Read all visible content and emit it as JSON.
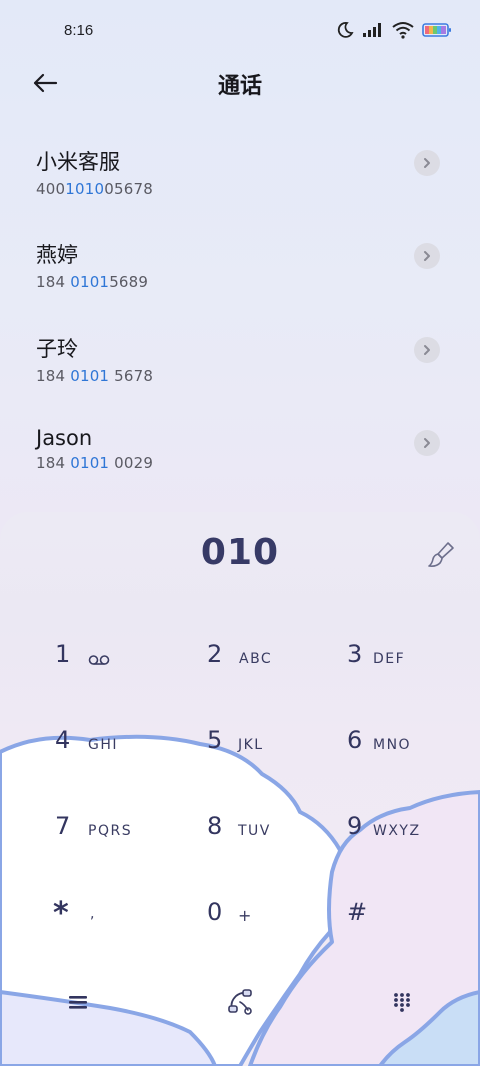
{
  "status_bar": {
    "time": "8:16",
    "icons": [
      "moon-icon",
      "signal-icon",
      "wifi-icon",
      "battery-icon"
    ]
  },
  "header": {
    "title": "通话",
    "back_icon": "arrow-left-icon"
  },
  "contacts": [
    {
      "name": "小米客服",
      "number_pre": "400",
      "number_hl": "1010",
      "number_post": "05678"
    },
    {
      "name": "燕婷",
      "number_pre": "184 ",
      "number_hl": "0101",
      "number_post": "5689"
    },
    {
      "name": "子玲",
      "number_pre": "184 ",
      "number_hl": "0101",
      "number_post": " 5678"
    },
    {
      "name": "Jason",
      "number_pre": "184 ",
      "number_hl": "0101",
      "number_post": " 0029"
    }
  ],
  "dialer": {
    "input": "010",
    "keys": [
      {
        "digit": "1",
        "letters": ""
      },
      {
        "digit": "2",
        "letters": "ABC"
      },
      {
        "digit": "3",
        "letters": "DEF"
      },
      {
        "digit": "4",
        "letters": "GHI"
      },
      {
        "digit": "5",
        "letters": "JKL"
      },
      {
        "digit": "6",
        "letters": "MNO"
      },
      {
        "digit": "7",
        "letters": "PQRS"
      },
      {
        "digit": "8",
        "letters": "TUV"
      },
      {
        "digit": "9",
        "letters": "WXYZ"
      },
      {
        "digit": "*",
        "letters": ","
      },
      {
        "digit": "0",
        "letters": "+"
      },
      {
        "digit": "#",
        "letters": ""
      }
    ]
  },
  "colors": {
    "highlight": "#2f76d6",
    "keypad_text": "#33355f",
    "cloud_outline": "#8aa6e6"
  }
}
